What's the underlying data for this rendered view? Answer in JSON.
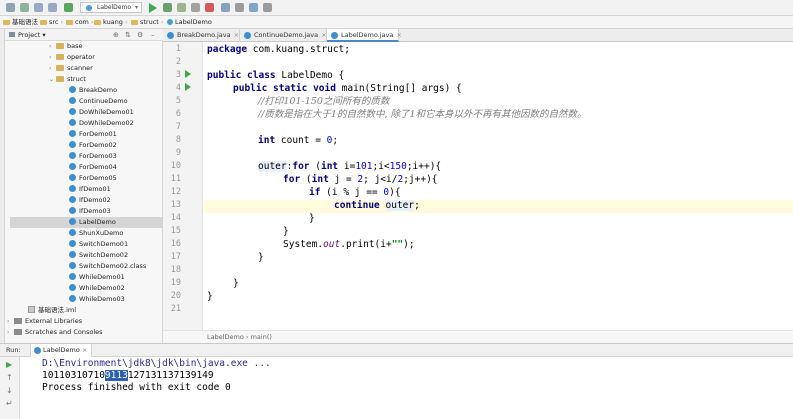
{
  "toolbar": {
    "run_config": "LabelDemo"
  },
  "breadcrumb": [
    "基础语法",
    "src",
    "com",
    "kuang",
    "struct",
    "LabelDemo"
  ],
  "project_panel": {
    "title": "Project",
    "tree": [
      {
        "label": "base",
        "kind": "folder",
        "arrow": "›"
      },
      {
        "label": "operator",
        "kind": "folder",
        "arrow": "›"
      },
      {
        "label": "scanner",
        "kind": "folder",
        "arrow": "›"
      },
      {
        "label": "struct",
        "kind": "folder",
        "arrow": "⌄"
      },
      {
        "label": "BreakDemo",
        "kind": "class"
      },
      {
        "label": "ContinueDemo",
        "kind": "class"
      },
      {
        "label": "DoWhileDemo01",
        "kind": "class"
      },
      {
        "label": "DoWhileDemo02",
        "kind": "class"
      },
      {
        "label": "ForDemo01",
        "kind": "class"
      },
      {
        "label": "ForDemo02",
        "kind": "class"
      },
      {
        "label": "ForDemo03",
        "kind": "class"
      },
      {
        "label": "ForDemo04",
        "kind": "class"
      },
      {
        "label": "ForDemo05",
        "kind": "class"
      },
      {
        "label": "IfDemo01",
        "kind": "class"
      },
      {
        "label": "IfDemo02",
        "kind": "class"
      },
      {
        "label": "IfDemo03",
        "kind": "class"
      },
      {
        "label": "LabelDemo",
        "kind": "class",
        "selected": true
      },
      {
        "label": "ShunXuDemo",
        "kind": "class"
      },
      {
        "label": "SwitchDemo01",
        "kind": "class"
      },
      {
        "label": "SwitchDemo02",
        "kind": "class"
      },
      {
        "label": "SwitchDemo02.class",
        "kind": "class"
      },
      {
        "label": "WhileDemo01",
        "kind": "class"
      },
      {
        "label": "WhileDemo02",
        "kind": "class"
      },
      {
        "label": "WhileDemo03",
        "kind": "class"
      },
      {
        "label": "基础语法.iml",
        "kind": "iml"
      },
      {
        "label": "External Libraries",
        "kind": "lib",
        "arrow": "›"
      },
      {
        "label": "Scratches and Consoles",
        "kind": "lib",
        "arrow": "›"
      }
    ]
  },
  "tabs": [
    {
      "label": "BreakDemo.java",
      "active": false
    },
    {
      "label": "ContinueDemo.java",
      "active": false
    },
    {
      "label": "LabelDemo.java",
      "active": true
    }
  ],
  "editor": {
    "line_numbers": [
      "1",
      "2",
      "3",
      "4",
      "5",
      "6",
      "7",
      "8",
      "9",
      "10",
      "11",
      "12",
      "13",
      "14",
      "15",
      "16",
      "17",
      "18",
      "19",
      "20",
      "21"
    ],
    "code": {
      "l1_kw": "package",
      "l1_rest": " com.kuang.struct;",
      "l3_kw": "public class",
      "l3_rest": " LabelDemo {",
      "l4_kw": "public static void",
      "l4_rest": " main(String[] args) {",
      "l5_comment": "//打印101-150之间所有的质数",
      "l6_comment": "//质数是指在大于1的自然数中, 除了1和它本身以外不再有其他因数的自然数。",
      "l8_kw": "int",
      "l8_rest": " count = ",
      "l8_num": "0",
      "l8_end": ";",
      "l10_label": "outer",
      "l10_a": ":",
      "l10_kw1": "for",
      "l10_b": " (",
      "l10_kw2": "int",
      "l10_c": " i=",
      "l10_n1": "101",
      "l10_d": ";i<",
      "l10_n2": "150",
      "l10_e": ";i++){",
      "l11_kw1": "for",
      "l11_a": " (",
      "l11_kw2": "int",
      "l11_b": " j = ",
      "l11_n1": "2",
      "l11_c": "; j<i/",
      "l11_n2": "2",
      "l11_d": ";j++){",
      "l12_kw": "if",
      "l12_a": " (i % j == ",
      "l12_n": "0",
      "l12_b": "){",
      "l13_kw": "continue",
      "l13_a": " ",
      "l13_label": "outer",
      "l13_b": ";",
      "l14": "}",
      "l15": "}",
      "l16_a": "System.",
      "l16_field": "out",
      "l16_b": ".print(i+",
      "l16_str": "\"\"",
      "l16_c": ");",
      "l17": "}",
      "l19": "}",
      "l20": "}"
    },
    "breadcrumb": "LabelDemo  ›  main()"
  },
  "run_panel": {
    "label": "Run:",
    "tab": "LabelDemo",
    "cmd": "D:\\Environment\\jdk8\\jdk\\bin\\java.exe ...",
    "out_before": "10110310710",
    "out_sel": "9113",
    "out_after": "127131137139149",
    "finish": "Process finished with exit code 0"
  }
}
